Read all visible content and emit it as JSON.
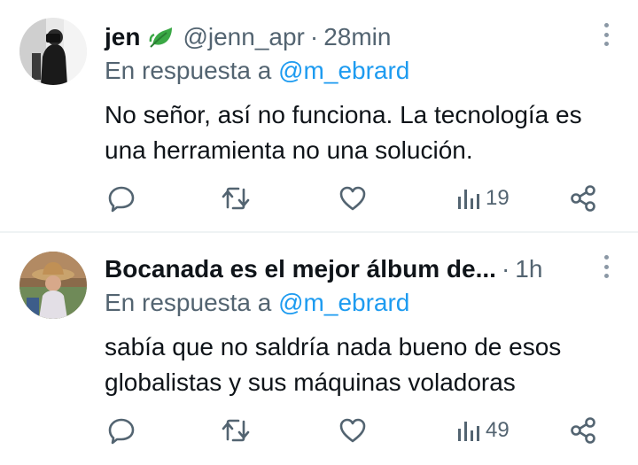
{
  "tweets": [
    {
      "display_name": "jen",
      "badge_icon": "leaf-icon",
      "handle": "@jenn_apr",
      "separator": "·",
      "time": "28min",
      "reply_prefix": "En respuesta a",
      "reply_mention": "@m_ebrard",
      "text": "No señor, así no funciona. La tecnología es una herramienta no una solución.",
      "views": "19"
    },
    {
      "display_name": "Bocanada es el mejor álbum de...",
      "handle": "",
      "separator": "·",
      "time": "1h",
      "reply_prefix": "En respuesta a",
      "reply_mention": "@m_ebrard",
      "text": "sabía que no saldría nada bueno de esos globalistas y sus máquinas voladoras",
      "views": "49"
    }
  ],
  "icons": {
    "reply": "comment-icon",
    "retweet": "retweet-icon",
    "like": "heart-icon",
    "views": "views-bar-chart-icon",
    "share": "share-icon",
    "more": "more-vertical-icon"
  },
  "colors": {
    "text": "#0f1419",
    "secondary": "#536471",
    "mention": "#1d9bf0",
    "divider": "#eff3f4",
    "leaf": "#3aa845"
  }
}
